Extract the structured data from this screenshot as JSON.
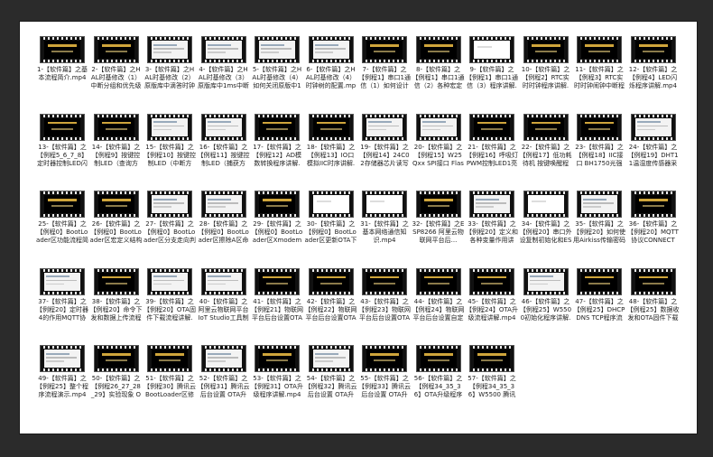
{
  "files": [
    {
      "name": "1-【软件篇】之基本流程简介.mp4",
      "thumb": "title"
    },
    {
      "name": "2-【软件篇】之HAL时基修改（1）中断分组和优先级的概念.mp4",
      "thumb": "title"
    },
    {
      "name": "3-【软件篇】之HAL时基修改（2）原版库中滴答时钟1ms中断...",
      "thumb": "screen"
    },
    {
      "name": "4-【软件篇】之HAL时基修改（3）原版库中1ms中断如何判断...",
      "thumb": "screen"
    },
    {
      "name": "5-【软件篇】之HAL时基修改（4）如何关闭原版中1ms中断并...",
      "thumb": "screen"
    },
    {
      "name": "6-【软件篇】之HAL时基修改（4）时钟树的配置.mp4",
      "thumb": "screen"
    },
    {
      "name": "7-【软件篇】之【例程1】串口1通信（1）如何设计接收的和标...",
      "thumb": "title"
    },
    {
      "name": "8-【软件篇】之【例程1】串口1通信（2）各种宏定义 结构体 变...",
      "thumb": "title"
    },
    {
      "name": "9-【软件篇】之【例程1】串口1通信（3）程序讲解.mp4",
      "thumb": "white"
    },
    {
      "name": "10-【软件篇】之【例程2】RTC实时时钟程序讲解.mp4",
      "thumb": "title"
    },
    {
      "name": "11-【软件篇】之【例程3】RTC实时时钟闹钟中断程序讲解.mp4",
      "thumb": "title"
    },
    {
      "name": "12-【软件篇】之【例程4】LED闪烁程序讲解.mp4",
      "thumb": "title"
    },
    {
      "name": "13-【软件篇】之【例程5_6_7_8】定时器控制LED闪烁程序讲解...",
      "thumb": "title"
    },
    {
      "name": "14-【软件篇】之【例程9】按键控制LED（查询方式）程序讲解...",
      "thumb": "title"
    },
    {
      "name": "15-【软件篇】之【例程10】按键控制LED（中断方式）程序讲...",
      "thumb": "screen"
    },
    {
      "name": "16-【软件篇】之【例程11】按键控制LED（捕获方式）程序讲...",
      "thumb": "screen"
    },
    {
      "name": "17-【软件篇】之【例程12】AD模数转换程序讲解.mp4",
      "thumb": "title"
    },
    {
      "name": "18-【软件篇】之【例程13】IO口模拟IIC时序讲解.mp4",
      "thumb": "title"
    },
    {
      "name": "19-【软件篇】之【例程14】24C02存储器芯片读写程序讲...",
      "thumb": "screen"
    },
    {
      "name": "20-【软件篇】之【例程15】W25Qxx SPI接口 Flash存储芯...",
      "thumb": "screen"
    },
    {
      "name": "21-【软件篇】之【例程16】呼吸灯 PWM控制LED1亮度程序讲...",
      "thumb": "title"
    },
    {
      "name": "22-【软件篇】之【例程17】低功耗待机 按键唤醒程序讲解.mp4",
      "thumb": "title"
    },
    {
      "name": "23-【软件篇】之【例程18】IIC接口 BH1750光强度传感器采集...",
      "thumb": "title"
    },
    {
      "name": "24-【软件篇】之【例程19】DHT11温湿度传感器采集实验...",
      "thumb": "screen"
    },
    {
      "name": "25-【软件篇】之【例程0】BootLoader区功能流程简介...",
      "thumb": "title"
    },
    {
      "name": "26-【软件篇】之【例程0】BootLoader区宏定义结构体...",
      "thumb": "title"
    },
    {
      "name": "27-【软件篇】之【例程0】BootLoader区分支走向判断...",
      "thumb": "screen"
    },
    {
      "name": "28-【软件篇】之【例程0】BootLoader区擦除A区命令...",
      "thumb": "screen"
    },
    {
      "name": "29-【软件篇】之【例程0】BootLoader区Xmodem下载...",
      "thumb": "title"
    },
    {
      "name": "30-【软件篇】之【例程0】BootLoader区更新OTA下载...",
      "thumb": "white"
    },
    {
      "name": "31-【软件篇】之基本网络通信知识.mp4",
      "thumb": "white"
    },
    {
      "name": "32-【软件篇】之ESP8266 阿里云物联网平台后...",
      "thumb": "title"
    },
    {
      "name": "33-【软件篇】之【例程20】定义和各种变量作用讲解.mp4",
      "thumb": "screen"
    },
    {
      "name": "34-【软件篇】之【例程20】串口外设复制初始化和ESP8266连接...",
      "thumb": "white"
    },
    {
      "name": "35-【软件篇】之【例程20】如何使用Airkiss传输密码流程讲解...",
      "thumb": "screen"
    },
    {
      "name": "36-【软件篇】之【例程20】MQTT协议CONNECT报...",
      "thumb": "title"
    },
    {
      "name": "37-【软件篇】之【例程20】定时器4的作用MQTT协议PIN...",
      "thumb": "screen"
    },
    {
      "name": "38-【软件篇】之【例程20】命令下发和数据上传流程讲解.mp4",
      "thumb": "title"
    },
    {
      "name": "39-【软件篇】之【例程20】OTA固件下载流程讲解.mp4",
      "thumb": "screen"
    },
    {
      "name": "40-【软件篇】之阿里云物联网平台IoT Studio工具制作WEB控...",
      "thumb": "screen"
    },
    {
      "name": "41-【软件篇】之【例程21】物联网平台后台设置OTA升级流程...",
      "thumb": "title"
    },
    {
      "name": "42-【软件篇】之【例程22】物联网平台后台设置OTA升级流程...",
      "thumb": "title"
    },
    {
      "name": "43-【软件篇】之【例程23】物联网平台后台设置OTA升级流程...",
      "thumb": "title"
    },
    {
      "name": "44-【软件篇】之【例程24】物联网平台后台设置自定义综合APP...",
      "thumb": "title"
    },
    {
      "name": "45-【软件篇】之【例程24】OTA升级流程讲解.mp4",
      "thumb": "title"
    },
    {
      "name": "46-【软件篇】之【例程25】W5500初始化程序讲解.mp4",
      "thumb": "screen"
    },
    {
      "name": "47-【软件篇】之【例程25】DHCP DNS TCP程序流程讲解...",
      "thumb": "title"
    },
    {
      "name": "48-【软件篇】之【例程25】数据收发和OTA固件下载讲解.mp4",
      "thumb": "title"
    },
    {
      "name": "49-【软件篇】之【例程25】整个程序流程演示.mp4",
      "thumb": "screen"
    },
    {
      "name": "50-【软件篇】之【例程26_27_28_29】实验现象 OTA...",
      "thumb": "title"
    },
    {
      "name": "51-【软件篇】之【例程30】腾讯云BootLoader区修改讲解.mp4",
      "thumb": "title"
    },
    {
      "name": "52-【软件篇】之【例程31】腾讯云后台设置 OTA升级流程演示...",
      "thumb": "screen"
    },
    {
      "name": "53-【软件篇】之【例程31】OTA升级程序讲解.mp4",
      "thumb": "title"
    },
    {
      "name": "54-【软件篇】之【例程32】腾讯云后台设置 OTA升级流程演示...",
      "thumb": "screen"
    },
    {
      "name": "55-【软件篇】之【例程33】腾讯云后台设置 OTA升级流程演示...",
      "thumb": "title"
    },
    {
      "name": "56-【软件篇】之【例程34_35_36】OTA升级程序演示.mp4",
      "thumb": "title"
    },
    {
      "name": "57-【软件篇】之【例程34_35_36】W5500 腾讯云OTA升级程序...",
      "thumb": "title"
    }
  ]
}
